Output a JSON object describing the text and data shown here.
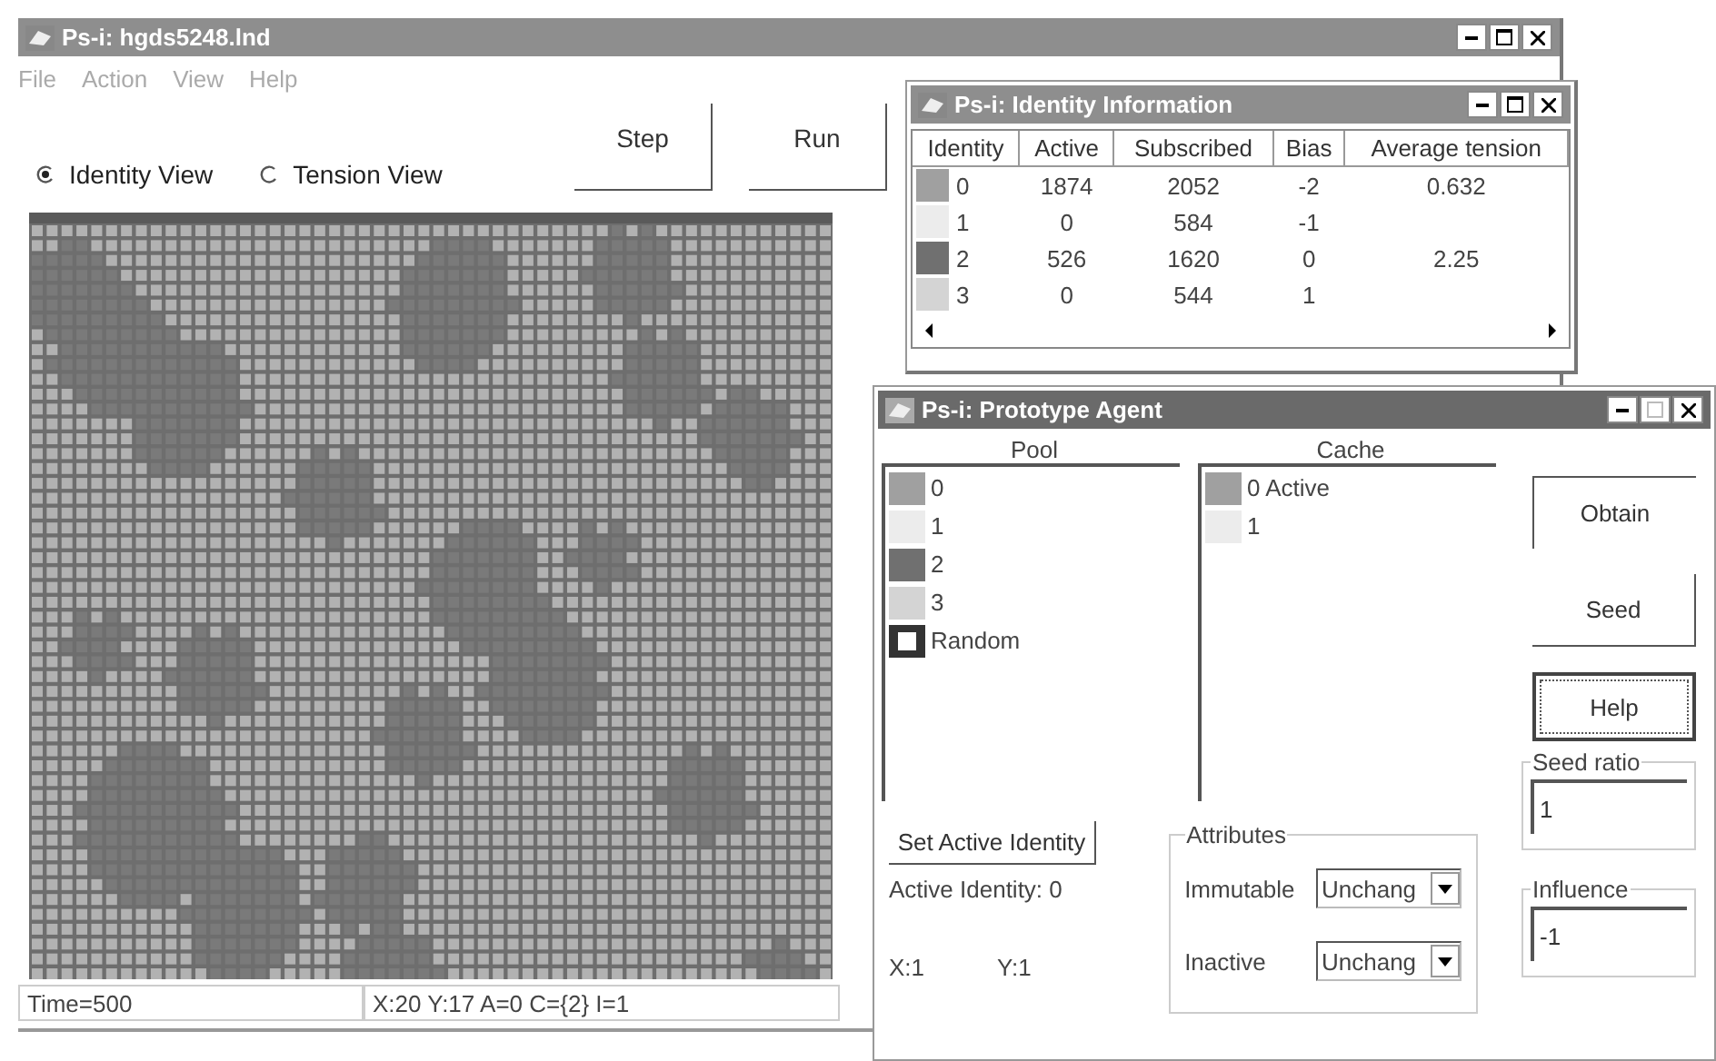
{
  "main_window": {
    "title": "Ps-i: hgds5248.lnd",
    "menu": [
      "File",
      "Action",
      "View",
      "Help"
    ],
    "views": [
      {
        "label": "Identity View",
        "selected": true
      },
      {
        "label": "Tension View",
        "selected": false
      }
    ],
    "buttons": [
      "Step",
      "Run"
    ],
    "status_bar": [
      "Time=500",
      "X:20  Y:17  A=0 C={2}  I=1"
    ]
  },
  "identity_window": {
    "title": "Ps-i: Identity Information",
    "columns": [
      "Identity",
      "Active",
      "Subscribed",
      "Bias",
      "Average tension"
    ],
    "rows": [
      {
        "identity": "0",
        "color": "#a0a0a0",
        "active": "1874",
        "subscribed": "2052",
        "bias": "-2",
        "average_tension": "0.632"
      },
      {
        "identity": "1",
        "color": "#ececec",
        "active": "0",
        "subscribed": "584",
        "bias": "-1"
      },
      {
        "identity": "2",
        "color": "#707070",
        "active": "526",
        "subscribed": "1620",
        "bias": "0",
        "average_tension": "2.25"
      },
      {
        "identity": "3",
        "color": "#d4d4d4",
        "active": "0",
        "subscribed": "544",
        "bias": "1"
      }
    ]
  },
  "agent_window": {
    "title": "Ps-i: Prototype Agent",
    "pool": {
      "label": "Pool",
      "items": [
        {
          "kind": "identity",
          "label": "0",
          "color": "#a0a0a0"
        },
        {
          "kind": "identity",
          "label": "1",
          "color": "#ececec"
        },
        {
          "kind": "identity",
          "label": "2",
          "color": "#707070"
        },
        {
          "kind": "identity",
          "label": "3",
          "color": "#d4d4d4"
        },
        {
          "kind": "random",
          "label": "Random"
        }
      ]
    },
    "cache": {
      "label": "Cache",
      "items": [
        {
          "label": "0 Active",
          "color": "#a0a0a0"
        },
        {
          "label": "1",
          "color": "#ececec"
        }
      ]
    },
    "buttons": [
      {
        "label": "Obtain",
        "focused": false
      },
      {
        "label": "Seed",
        "focused": false
      },
      {
        "label": "Help",
        "focused": true
      }
    ],
    "set_button": "Set Active Identity",
    "active_identity": "Active Identity: 0",
    "x": "X:1",
    "y": "Y:1",
    "attributes": {
      "label": "Attributes",
      "rows": [
        {
          "label": "Immutable",
          "value": "Unchang"
        },
        {
          "label": "Inactive",
          "value": "Unchang"
        }
      ]
    },
    "seed_ratio": {
      "label": "Seed ratio",
      "value": "1"
    },
    "influence": {
      "label": "Influence",
      "value": "-1"
    }
  }
}
